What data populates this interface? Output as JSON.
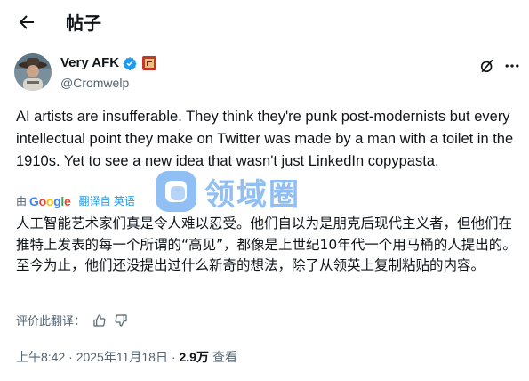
{
  "header": {
    "title": "帖子"
  },
  "author": {
    "display_name": "Very AFK",
    "handle": "@Cromwelp"
  },
  "tweet": {
    "text": "AI artists are insufferable. They think they're punk post-modernists but every intellectual point they make on Twitter was made by a man with a toilet in the 1910s. Yet to see a new idea that wasn't just LinkedIn copypasta."
  },
  "translation": {
    "by_prefix": "由",
    "provider": "Google",
    "action_label": "翻译自 英语",
    "text": "人工智能艺术家们真是令人难以忍受。他们自以为是朋克后现代主义者，但他们在推特上发表的每一个所谓的“高见”，都像是上世纪10年代一个用马桶的人提出的。至今为止，他们还没提出过什么新奇的想法，除了从领英上复制粘贴的内容。",
    "rate_label": "评价此翻译："
  },
  "meta": {
    "timestamp": "上午8:42 · 2025年11月18日 · ",
    "views": "2.9万",
    "views_label": "查看"
  },
  "watermark": {
    "text": "领域圈"
  },
  "colors": {
    "accent": "#1d9bf0",
    "muted": "#536471",
    "text": "#0f1419"
  },
  "icons": [
    "back-arrow-icon",
    "verified-badge-icon",
    "flag-icon",
    "grok-icon",
    "more-icon",
    "thumbs-up-icon",
    "thumbs-down-icon",
    "watermark-logo-icon"
  ]
}
